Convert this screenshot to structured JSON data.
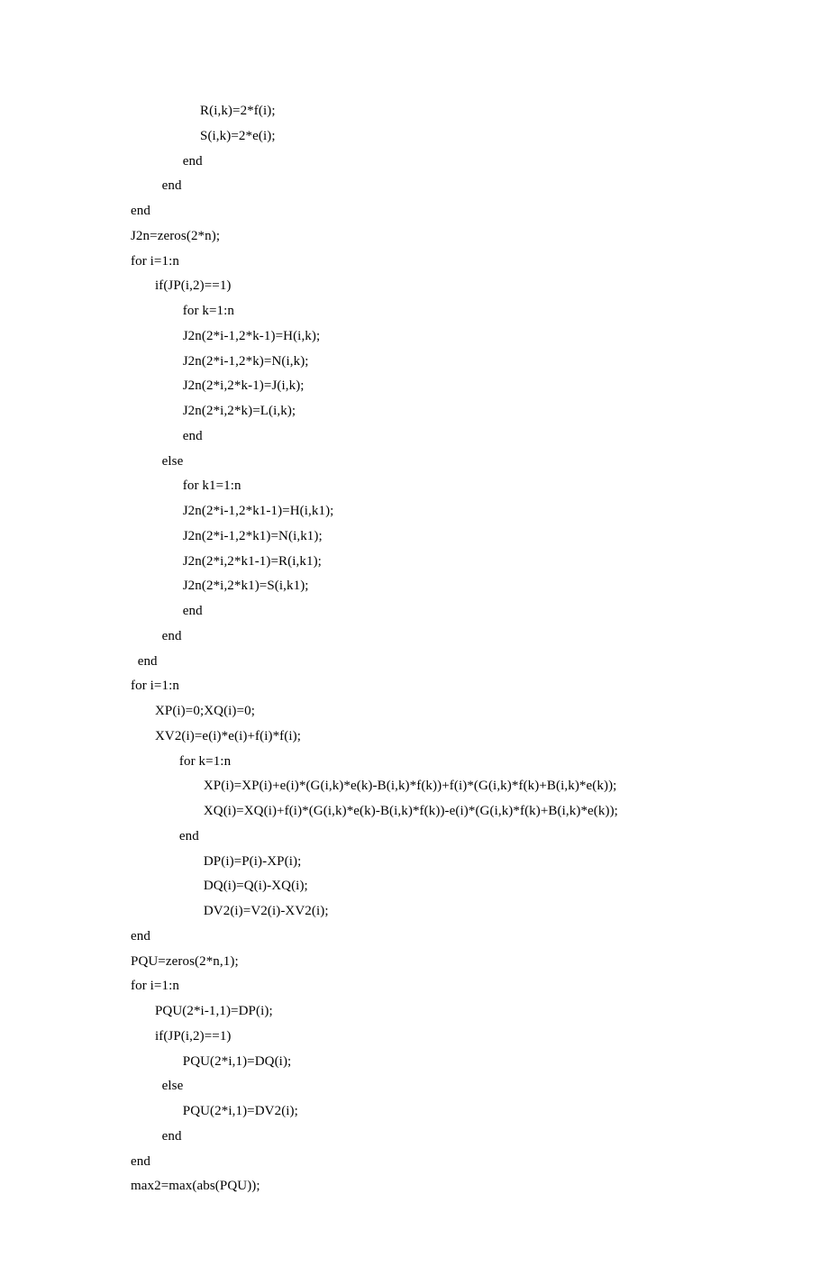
{
  "code_lines": [
    "                    R(i,k)=2*f(i);",
    "                    S(i,k)=2*e(i);",
    "               end",
    "         end",
    "end",
    "J2n=zeros(2*n);",
    "for i=1:n",
    "       if(JP(i,2)==1)",
    "               for k=1:n",
    "               J2n(2*i-1,2*k-1)=H(i,k);",
    "               J2n(2*i-1,2*k)=N(i,k);",
    "               J2n(2*i,2*k-1)=J(i,k);",
    "               J2n(2*i,2*k)=L(i,k);",
    "               end",
    "         else",
    "               for k1=1:n",
    "               J2n(2*i-1,2*k1-1)=H(i,k1);",
    "               J2n(2*i-1,2*k1)=N(i,k1);",
    "               J2n(2*i,2*k1-1)=R(i,k1);",
    "               J2n(2*i,2*k1)=S(i,k1);",
    "               end",
    "         end",
    "  end",
    "for i=1:n",
    "       XP(i)=0;XQ(i)=0;",
    "       XV2(i)=e(i)*e(i)+f(i)*f(i);",
    "              for k=1:n",
    "                     XP(i)=XP(i)+e(i)*(G(i,k)*e(k)-B(i,k)*f(k))+f(i)*(G(i,k)*f(k)+B(i,k)*e(k));",
    "                     XQ(i)=XQ(i)+f(i)*(G(i,k)*e(k)-B(i,k)*f(k))-e(i)*(G(i,k)*f(k)+B(i,k)*e(k));",
    "              end",
    "                     DP(i)=P(i)-XP(i);",
    "                     DQ(i)=Q(i)-XQ(i);",
    "                     DV2(i)=V2(i)-XV2(i);",
    "end",
    "PQU=zeros(2*n,1);",
    "for i=1:n",
    "       PQU(2*i-1,1)=DP(i);",
    "       if(JP(i,2)==1)",
    "               PQU(2*i,1)=DQ(i);",
    "         else",
    "               PQU(2*i,1)=DV2(i);",
    "         end",
    "end",
    "max2=max(abs(PQU));"
  ]
}
